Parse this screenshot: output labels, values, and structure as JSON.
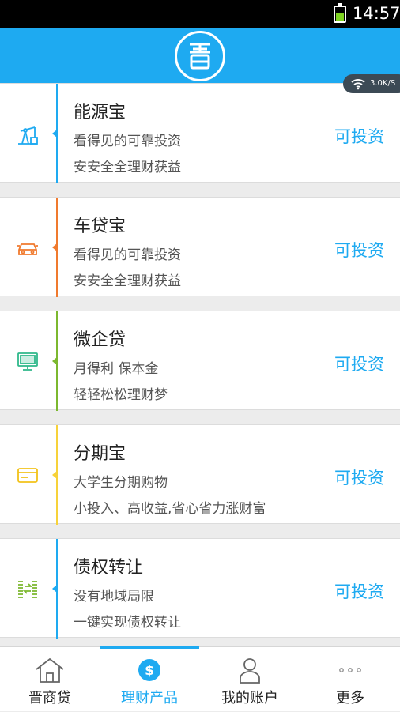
{
  "status_bar": {
    "time": "14:57"
  },
  "network_speed": "3.0K/S",
  "products": [
    {
      "name": "能源宝",
      "line1": "看得见的可靠投资",
      "line2": "安安全全理财获益",
      "action": "可投资",
      "accent": "#1eaaf1",
      "icon": "oil-pump-icon"
    },
    {
      "name": "车贷宝",
      "line1": "看得见的可靠投资",
      "line2": "安安全全理财获益",
      "action": "可投资",
      "accent": "#f07a2e",
      "icon": "car-icon"
    },
    {
      "name": "微企贷",
      "line1": "月得利 保本金",
      "line2": "轻轻松松理财梦",
      "action": "可投资",
      "accent": "#7cb82f",
      "icon": "monitor-icon"
    },
    {
      "name": "分期宝",
      "line1": "大学生分期购物",
      "line2": "小投入、高收益,省心省力涨财富",
      "action": "可投资",
      "accent": "#f7d23a",
      "icon": "card-icon"
    },
    {
      "name": "债权转让",
      "line1": "没有地域局限",
      "line2": "一键实现债权转让",
      "action": "可投资",
      "accent": "#1eaaf1",
      "icon": "transfer-icon"
    }
  ],
  "tabs": [
    {
      "label": "晋商贷",
      "icon": "home-icon",
      "active": false
    },
    {
      "label": "理财产品",
      "icon": "dollar-icon",
      "active": true
    },
    {
      "label": "我的账户",
      "icon": "user-icon",
      "active": false
    },
    {
      "label": "更多",
      "icon": "more-icon",
      "active": false
    }
  ],
  "colors": {
    "brand": "#1eaaf1"
  }
}
